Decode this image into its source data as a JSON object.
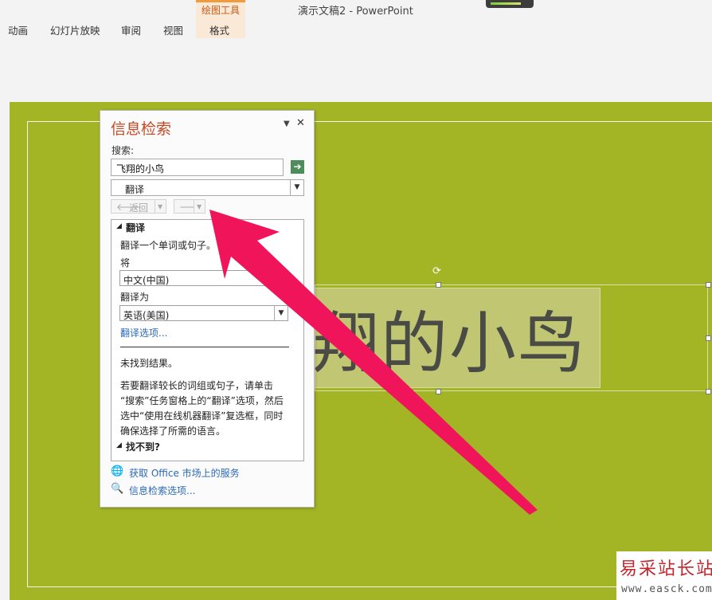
{
  "window": {
    "title": "演示文稿2 - PowerPoint",
    "context_tab_group": "绘图工具"
  },
  "ribbon_tabs": [
    {
      "label": "动画"
    },
    {
      "label": "幻灯片放映"
    },
    {
      "label": "审阅"
    },
    {
      "label": "视图"
    },
    {
      "label": "格式",
      "context": true
    }
  ],
  "slide": {
    "background_color": "#a3b424",
    "textbox_text": "翔的小鸟"
  },
  "research_pane": {
    "title": "信息检索",
    "search_label": "搜索:",
    "search_value": "飞翔的小鸟",
    "source_value": "翻译",
    "back_label": "返回",
    "results": {
      "section_title": "翻译",
      "instruction": "翻译一个单词或句子。",
      "from_label": "将",
      "from_value": "中文(中国)",
      "to_label": "翻译为",
      "to_value": "英语(美国)",
      "options_link": "翻译选项...",
      "no_result": "未找到结果。",
      "help_lines": [
        "若要翻译较长的词组或句子，请单击",
        "“搜索”任务窗格上的“翻译”选项，然后",
        "选中“使用在线机器翻译”复选框，同时",
        "确保选择了所需的语言。"
      ],
      "cant_find": "找不到?"
    },
    "footer": {
      "market_link": "获取 Office 市场上的服务",
      "options_link": "信息检索选项..."
    }
  },
  "annotation": {
    "arrow_color": "#f0145a"
  },
  "watermark": {
    "title": "易采站长站",
    "url": "www.easck.com"
  },
  "colors": {
    "accent_title": "#c24a25",
    "link": "#2a6ab8",
    "context_tab": "#f29b3c"
  }
}
